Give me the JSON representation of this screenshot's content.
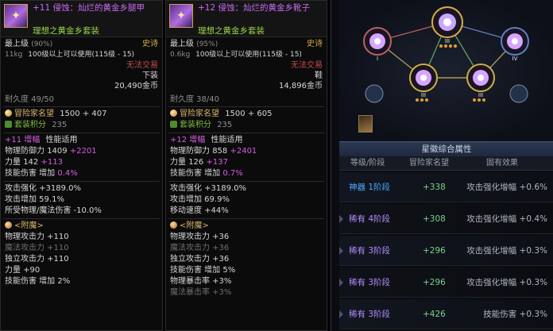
{
  "left": {
    "name": "+11 侵蚀：灿烂的黄金乡腿甲",
    "set": "理想之黄金乡套装",
    "level_label": "最上级",
    "level_pct": "(90%)",
    "rarity": "史诗",
    "weight": "11kg",
    "use_level": "100级以上可以使用(115级 - 15)",
    "trade": "无法交易",
    "slot": "下装",
    "price": "20,490金币",
    "durability": "耐久度 49/50",
    "rep_label": "冒险家名望",
    "rep": "1500 + 407",
    "set_points_label": "套装积分",
    "set_points": "235",
    "amp": "+11 增幅",
    "amp_type": "性能适用",
    "pdef_label": "物理防御力",
    "pdef": "1409",
    "pdef_plus": "+2201",
    "str_label": "力量",
    "str": "142",
    "str_plus": "+113",
    "skill_label": "技能伤害 增加",
    "skill_val": "0.4%",
    "stats": [
      "攻击强化 +3189.0%",
      "攻击增加 59.1%",
      "所受物理/魔法伤害 -10.0%"
    ],
    "enchant_title": "<附魔>",
    "enchant": [
      {
        "text": "物理攻击力 +110",
        "style": "white"
      },
      {
        "text": "魔法攻击力 +110",
        "style": "dim"
      },
      {
        "text": "独立攻击力 +110",
        "style": "white"
      },
      {
        "text": "力量 +90",
        "style": "white"
      },
      {
        "text": "技能伤害 增加 2%",
        "style": "white"
      }
    ]
  },
  "mid": {
    "name": "+12 侵蚀：灿烂的黄金乡靴子",
    "set": "理想之黄金乡套装",
    "level_label": "最上级",
    "level_pct": "(95%)",
    "rarity": "史诗",
    "weight": "0.6kg",
    "use_level": "100级以上可以使用(115级 - 15)",
    "trade": "无法交易",
    "slot": "鞋",
    "price": "14,896金币",
    "durability": "耐久度 38/40",
    "rep_label": "冒险家名望",
    "rep": "1500 + 605",
    "set_points_label": "套装积分",
    "set_points": "235",
    "amp": "+12 增幅",
    "amp_type": "性能适用",
    "pdef_label": "物理防御力",
    "pdef": "858",
    "pdef_plus": "+2401",
    "str_label": "力量",
    "str": "126",
    "str_plus": "+137",
    "skill_label": "技能伤害 增加",
    "skill_val": "0.7%",
    "stats": [
      "攻击强化 +3189.0%",
      "攻击增加 69.9%",
      "移动速度 +44%"
    ],
    "enchant_title": "<附魔>",
    "enchant": [
      {
        "text": "物理攻击力 +36",
        "style": "white"
      },
      {
        "text": "魔法攻击力 +36",
        "style": "dim"
      },
      {
        "text": "独立攻击力 +36",
        "style": "white"
      },
      {
        "text": "技能伤害 增加 5%",
        "style": "white"
      },
      {
        "text": "物理暴击率 +3%",
        "style": "white"
      },
      {
        "text": "魔法暴击率 +3%",
        "style": "dim"
      }
    ]
  },
  "right": {
    "panel_title": "星徽综合属性",
    "headers": [
      "等级/阶段",
      "冒险家名望",
      "固有效果"
    ],
    "rows": [
      {
        "grade": "神器 1阶段",
        "tier": "legend",
        "rep": "+338",
        "effect": "攻击强化增幅 +0.6%"
      },
      {
        "grade": "稀有 4阶段",
        "tier": "rare",
        "rep": "+308",
        "effect": "攻击强化增幅 +0.4%"
      },
      {
        "grade": "稀有 3阶段",
        "tier": "rare",
        "rep": "+296",
        "effect": "攻击强化增幅 +0.3%"
      },
      {
        "grade": "稀有 3阶段",
        "tier": "rare",
        "rep": "+296",
        "effect": "攻击强化增幅 +0.3%"
      },
      {
        "grade": "稀有 3阶段",
        "tier": "rare",
        "rep": "+426",
        "effect": "技能伤害 +0.3%"
      }
    ],
    "node_labels": [
      "III",
      "I",
      "IV",
      "III",
      "III"
    ]
  },
  "colors": {
    "epic_name": "#c86bf2",
    "set_green": "#9bd14a",
    "legend": "#4aa8ff",
    "rare": "#b58cff"
  }
}
